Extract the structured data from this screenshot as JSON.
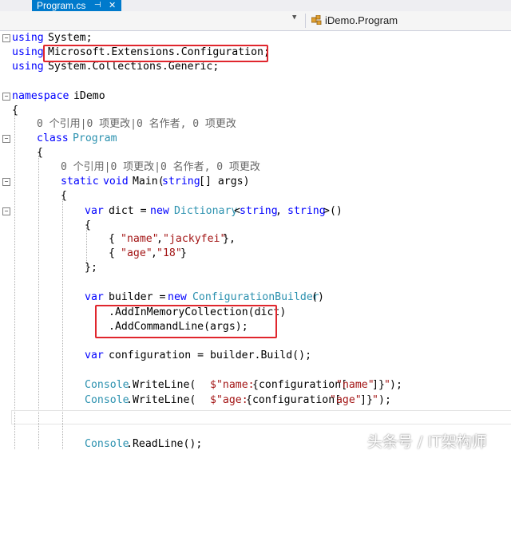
{
  "tab": {
    "title": "Program.cs",
    "pin_icon": "pin-icon",
    "close_icon": "close-icon"
  },
  "nav": {
    "member": "iDemo.Program"
  },
  "code": {
    "l1": [
      "using",
      " System;"
    ],
    "l2": [
      "using",
      "Microsoft.Extensions.Configuration;"
    ],
    "l3": [
      "using",
      " System.Collections.Generic;"
    ],
    "l5": [
      "namespace",
      " iDemo"
    ],
    "l6": "{",
    "lens1": "0 个引用|0 项更改|0 名作者, 0 项更改",
    "l7": [
      "class",
      " Program"
    ],
    "l8": "{",
    "lens2": "0 个引用|0 项更改|0 名作者, 0 项更改",
    "l9": [
      "static",
      " void",
      " Main(",
      "string",
      "[] args)"
    ],
    "l10": "{",
    "l11": [
      "var",
      " dict = ",
      "new",
      " Dictionary",
      "<",
      "string",
      ", ",
      "string",
      ">()"
    ],
    "l12": "{",
    "l13": [
      "{ ",
      "\"name\"",
      ",",
      "\"jackyfei\"",
      "},"
    ],
    "l14": [
      "{ ",
      "\"age\"",
      ",",
      "\"18\"",
      "}"
    ],
    "l15": "};",
    "l17": [
      "var",
      " builder = ",
      "new",
      " ConfigurationBuilder",
      "()"
    ],
    "l18": ".AddInMemoryCollection(dict)",
    "l19": ".AddCommandLine(args);",
    "l21": [
      "var",
      " configuration = builder.Build();"
    ],
    "l23": [
      "Console",
      ".WriteLine(",
      "$\"name:",
      "{configuration[",
      "\"name\"",
      "]}",
      "\"",
      ");"
    ],
    "l24": [
      "Console",
      ".WriteLine(",
      "$\"age:",
      "{configuration[",
      "\"age\"",
      "]}",
      "\"",
      ");"
    ],
    "l27": [
      "Console",
      ".ReadLine();"
    ]
  },
  "watermark": "头条号 / IT架构师"
}
